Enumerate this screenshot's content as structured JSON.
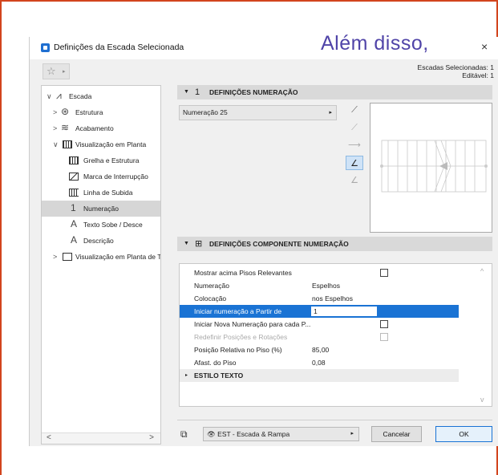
{
  "overlay_caption": "Além disso,",
  "window": {
    "title": "Definições da Escada Selecionada",
    "close_glyph": "×"
  },
  "favorites": {
    "star_glyph": "☆",
    "arrow_glyph": "▸"
  },
  "selection_info": {
    "line1": "Escadas Selecionadas: 1",
    "line2": "Editável: 1"
  },
  "tree": {
    "items": [
      {
        "label": "Escada",
        "twisty": "∨"
      },
      {
        "label": "Estrutura",
        "twisty": ">"
      },
      {
        "label": "Acabamento",
        "twisty": ">"
      },
      {
        "label": "Visualização em Planta",
        "twisty": "∨"
      },
      {
        "label": "Grelha e Estrutura"
      },
      {
        "label": "Marca de Interrupção"
      },
      {
        "label": "Linha de Subida"
      },
      {
        "label": "Numeração",
        "selected": true
      },
      {
        "label": "Texto Sobe / Desce"
      },
      {
        "label": "Descrição"
      },
      {
        "label": "Visualização em Planta de T",
        "twisty": ">"
      }
    ],
    "scroll_left": "<",
    "scroll_right": ">"
  },
  "section_numbering": {
    "title": "DEFINIÇÕES NUMERAÇÃO",
    "icon": "1",
    "collapse_glyph": "▼",
    "selector": {
      "value": "Numeração 25",
      "arrow": "▸"
    }
  },
  "section_component": {
    "title": "DEFINIÇÕES COMPONENTE NUMERAÇÃO",
    "collapse_glyph": "▼",
    "rows": [
      {
        "label": "Mostrar acima Pisos Relevantes",
        "value": "",
        "checkbox": true
      },
      {
        "label": "Numeração",
        "value": "Espelhos"
      },
      {
        "label": "Colocação",
        "value": "nos Espelhos"
      },
      {
        "label": "Iniciar numeração a Partir de",
        "value": "1",
        "selected": true
      },
      {
        "label": "Iniciar Nova Numeração para cada P...",
        "value": "",
        "checkbox": true
      },
      {
        "label": "Redefinir Posições e Rotações",
        "value": "",
        "checkbox": true,
        "disabled": true
      },
      {
        "label": "Posição Relativa no Piso (%)",
        "value": "85,00"
      },
      {
        "label": "Afast. do Piso",
        "value": "0,08"
      }
    ],
    "subsection": {
      "label": "ESTILO TEXTO",
      "glyph": "▸"
    },
    "scroll_up": "^",
    "scroll_down": "v"
  },
  "footer": {
    "layer_value": "EST - Escada & Rampa",
    "layer_arrow": "▸",
    "cancel_label": "Cancelar",
    "ok_label": "OK"
  },
  "colors": {
    "frame_border": "#d2451e",
    "selection": "#1a73d4",
    "overlay_text": "#5044a8"
  }
}
